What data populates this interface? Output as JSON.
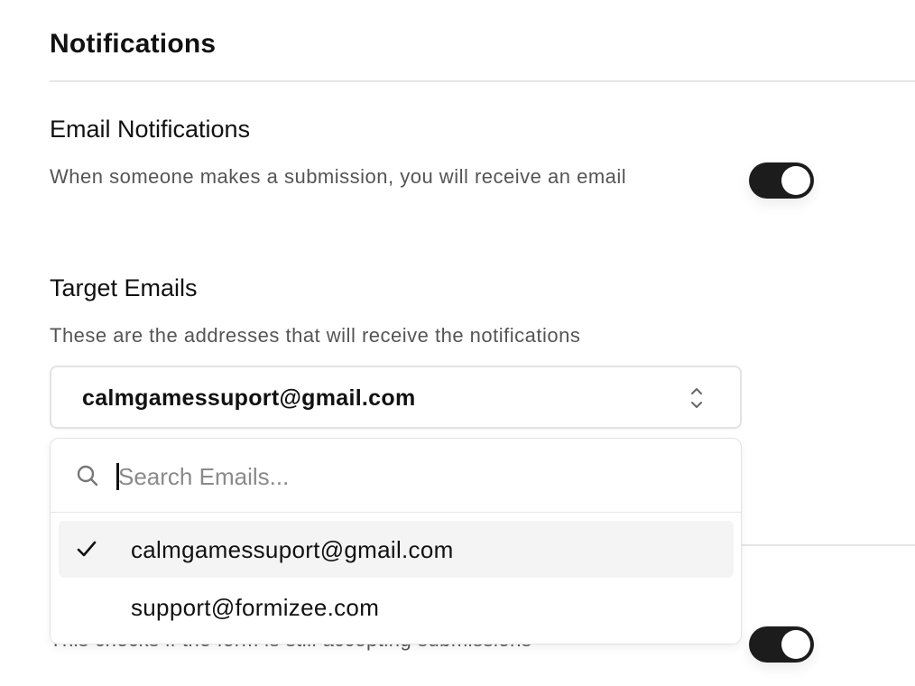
{
  "page": {
    "title": "Notifications"
  },
  "email_notifications": {
    "title": "Email Notifications",
    "description": "When someone makes a submission, you will receive an email",
    "enabled": true
  },
  "target_emails": {
    "title": "Target Emails",
    "description": "These are the addresses that will receive the notifications",
    "selected_value": "calmgamessuport@gmail.com",
    "search": {
      "placeholder": "Search Emails...",
      "value": ""
    },
    "options": [
      {
        "label": "calmgamessuport@gmail.com",
        "selected": true
      },
      {
        "label": "support@formizee.com",
        "selected": false
      }
    ]
  },
  "accepting_submissions": {
    "description": "This checks if the form is still accepting submissions",
    "enabled": true
  },
  "icons": {
    "search": "search-icon",
    "check": "check-icon",
    "select_arrows": "chevron-up-down-icon"
  },
  "colors": {
    "toggle_on": "#1c1c1c",
    "option_selected_bg": "#f4f4f4",
    "muted_text": "#555555"
  }
}
